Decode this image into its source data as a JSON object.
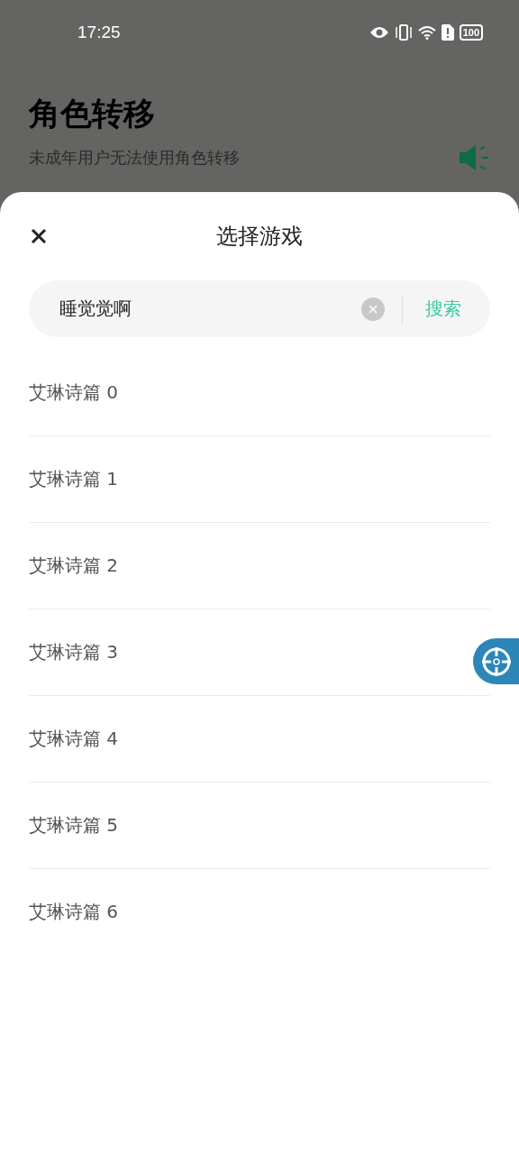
{
  "status_bar": {
    "time": "17:25",
    "battery": "100"
  },
  "page": {
    "title": "角色转移",
    "subtitle": "未成年用户无法使用角色转移"
  },
  "sheet": {
    "title": "选择游戏",
    "search": {
      "value": "睡觉觉啊",
      "button": "搜索"
    },
    "items": [
      {
        "label": "艾琳诗篇 0"
      },
      {
        "label": "艾琳诗篇 1"
      },
      {
        "label": "艾琳诗篇 2"
      },
      {
        "label": "艾琳诗篇 3"
      },
      {
        "label": "艾琳诗篇 4"
      },
      {
        "label": "艾琳诗篇 5"
      },
      {
        "label": "艾琳诗篇 6"
      }
    ]
  }
}
